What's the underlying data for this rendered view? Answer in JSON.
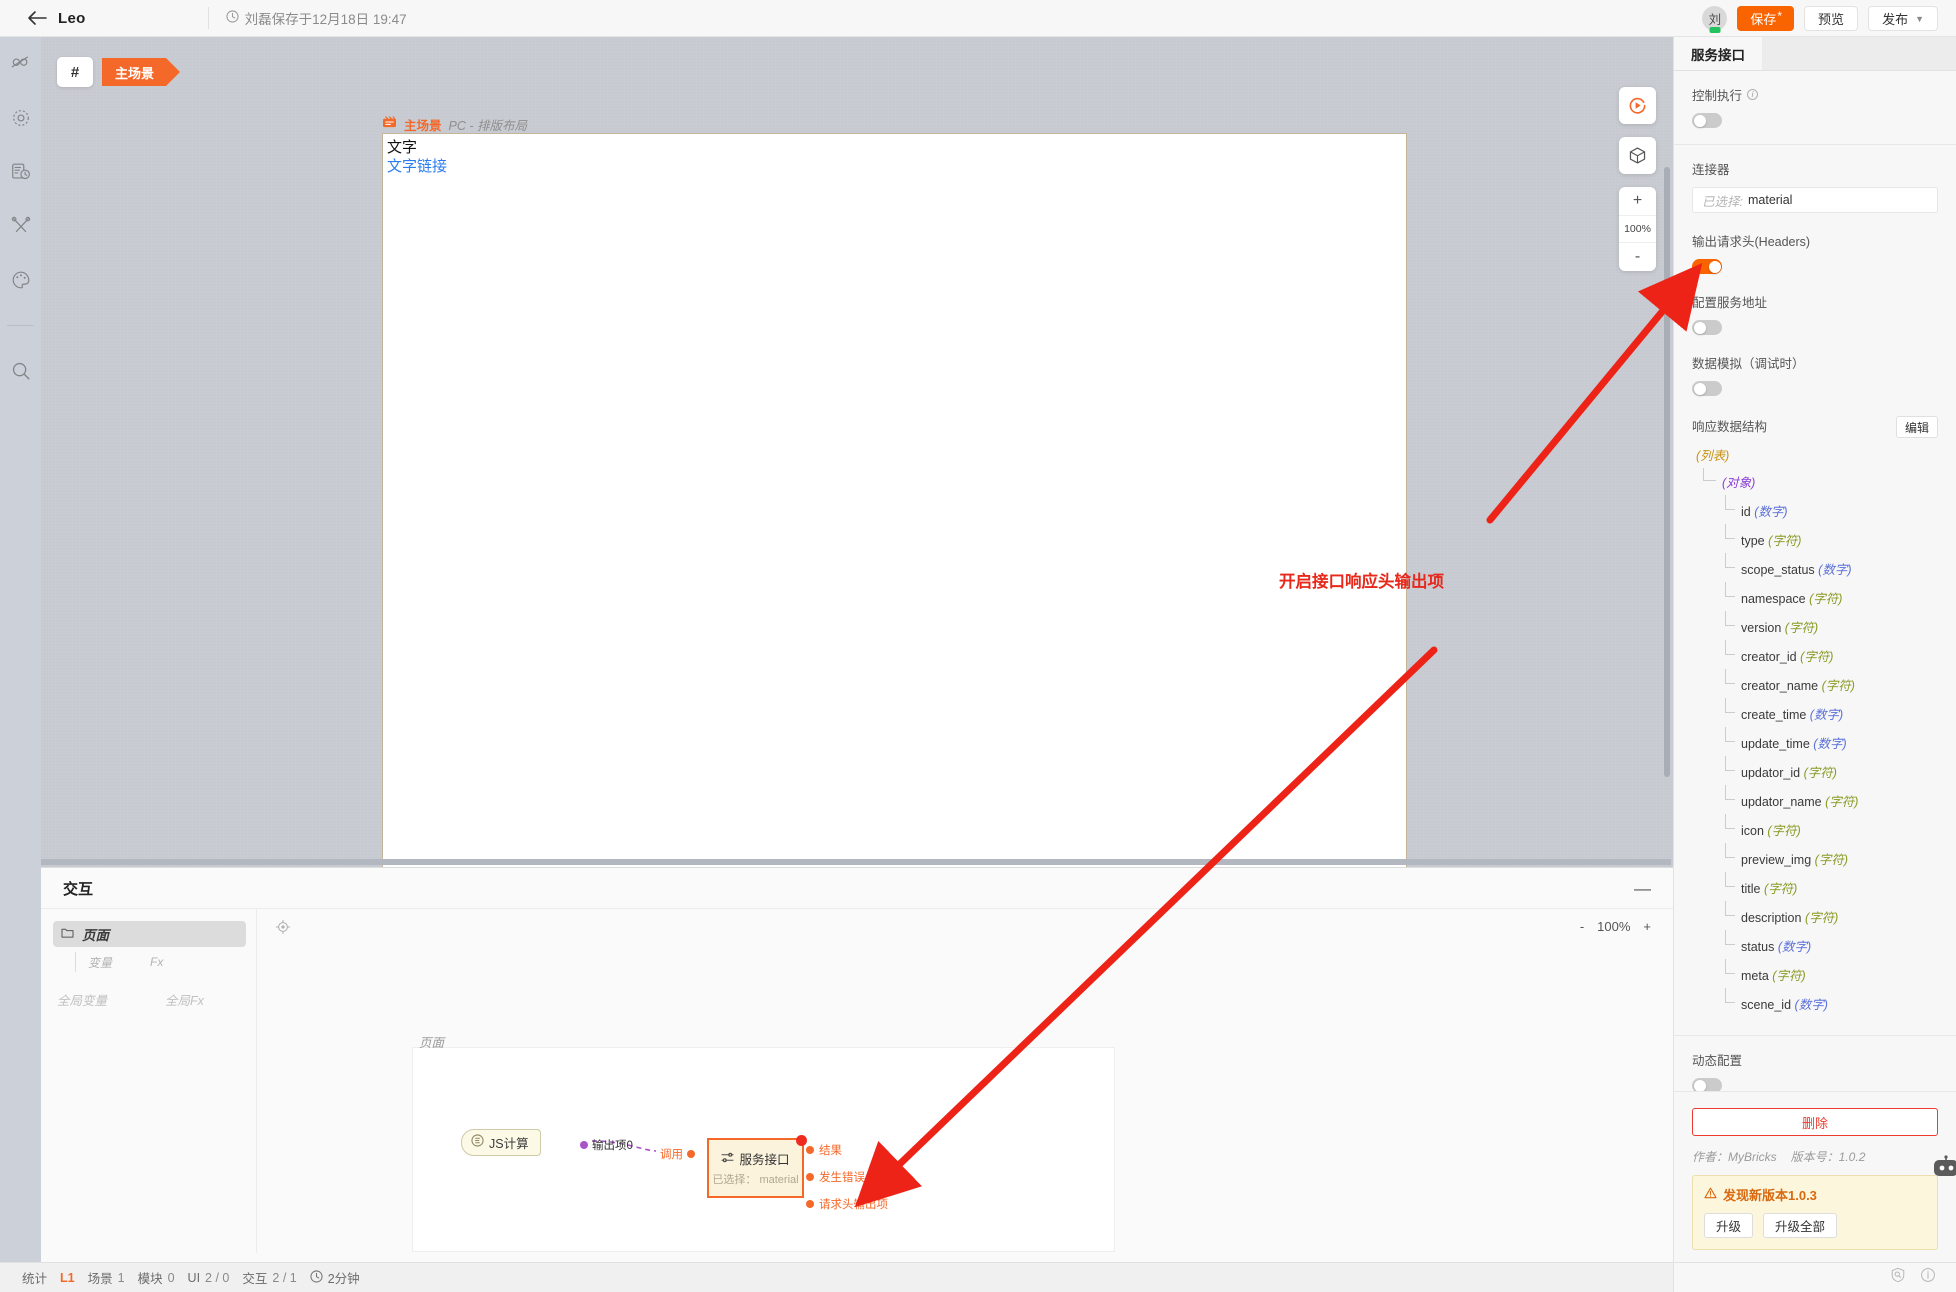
{
  "topbar": {
    "back_icon": "arrow-left-icon",
    "title": "Leo",
    "clock_icon": "clock-icon",
    "save_info": "刘磊保存于12月18日 19:47",
    "avatar_initial": "刘",
    "save_label": "保存",
    "save_star": "*",
    "preview_label": "预览",
    "publish_label": "发布",
    "publish_caret": "chevron-down-icon"
  },
  "rail": {
    "items": [
      {
        "name": "connector-icon",
        "label": "连接器"
      },
      {
        "name": "gear-icon",
        "label": "设置"
      },
      {
        "name": "history-icon",
        "label": "历史"
      },
      {
        "name": "tools-icon",
        "label": "工具"
      },
      {
        "name": "palette-icon",
        "label": "主题"
      },
      {
        "name": "search-icon",
        "label": "搜索"
      }
    ]
  },
  "canvas": {
    "hash_label": "#",
    "scene_tag": "主场景",
    "page_header_icon": "scene-icon",
    "page_header_label": "主场景",
    "page_header_sub": "PC - 排版布局",
    "sheet_text": "文字",
    "sheet_link": "文字链接",
    "tools": {
      "run_icon": "play-circle-icon",
      "cube_icon": "cube-icon",
      "zoom_in": "+",
      "zoom_value": "100%",
      "zoom_out": "-"
    },
    "annotation": "开启接口响应头输出项"
  },
  "interaction": {
    "title": "交互",
    "minimize_icon": "minimize-icon",
    "tree": {
      "folder_icon": "folder-icon",
      "root_label": "页面",
      "sub_items": [
        "变量",
        "Fx"
      ],
      "global_items": [
        "全局变量",
        "全局Fx"
      ]
    },
    "toolbar": {
      "focus_icon": "target-icon",
      "zoom_out": "-",
      "zoom_value": "100%",
      "zoom_in": "+"
    },
    "flow": {
      "frame_label": "页面",
      "js_node": {
        "icon": "js-icon",
        "label": "JS计算"
      },
      "js_output_port": "输出项0",
      "call_port": "调用",
      "api_node": {
        "icon": "api-icon",
        "title": "服务接口",
        "subtitle_prefix": "已选择：",
        "subtitle_value": "material"
      },
      "api_outputs": [
        "结果",
        "发生错误",
        "请求头输出项"
      ]
    }
  },
  "right_panel": {
    "tab_label": "服务接口",
    "control_exec": {
      "label": "控制执行",
      "info_icon": "info-icon",
      "enabled": false
    },
    "connector": {
      "label": "连接器",
      "placeholder": "已选择:",
      "value": "material"
    },
    "output_headers": {
      "label": "输出请求头(Headers)",
      "enabled": true
    },
    "config_service_url": {
      "label": "配置服务地址",
      "enabled": false
    },
    "data_mock": {
      "label": "数据模拟（调试时）",
      "enabled": false
    },
    "response_structure": {
      "label": "响应数据结构",
      "edit_label": "编辑",
      "root_type": "(列表)",
      "object_type": "(对象)",
      "fields": [
        {
          "name": "id",
          "type": "(数字)",
          "kind": "num"
        },
        {
          "name": "type",
          "type": "(字符)",
          "kind": "str"
        },
        {
          "name": "scope_status",
          "type": "(数字)",
          "kind": "num"
        },
        {
          "name": "namespace",
          "type": "(字符)",
          "kind": "str"
        },
        {
          "name": "version",
          "type": "(字符)",
          "kind": "str"
        },
        {
          "name": "creator_id",
          "type": "(字符)",
          "kind": "str"
        },
        {
          "name": "creator_name",
          "type": "(字符)",
          "kind": "str"
        },
        {
          "name": "create_time",
          "type": "(数字)",
          "kind": "num"
        },
        {
          "name": "update_time",
          "type": "(数字)",
          "kind": "num"
        },
        {
          "name": "updator_id",
          "type": "(字符)",
          "kind": "str"
        },
        {
          "name": "updator_name",
          "type": "(字符)",
          "kind": "str"
        },
        {
          "name": "icon",
          "type": "(字符)",
          "kind": "str"
        },
        {
          "name": "preview_img",
          "type": "(字符)",
          "kind": "str"
        },
        {
          "name": "title",
          "type": "(字符)",
          "kind": "str"
        },
        {
          "name": "description",
          "type": "(字符)",
          "kind": "str"
        },
        {
          "name": "status",
          "type": "(数字)",
          "kind": "num"
        },
        {
          "name": "meta",
          "type": "(字符)",
          "kind": "str"
        },
        {
          "name": "scene_id",
          "type": "(数字)",
          "kind": "num"
        }
      ]
    },
    "dynamic_config": {
      "label": "动态配置",
      "enabled": false
    },
    "delete_label": "删除",
    "author_line": "作者：MyBricks",
    "version_line": "版本号：1.0.2",
    "upgrade": {
      "warn_icon": "warning-icon",
      "title": "发现新版本1.0.3",
      "upgrade_label": "升级",
      "upgrade_all_label": "升级全部"
    },
    "bottom_icons": [
      "shield-search-icon",
      "info-circle-icon"
    ]
  },
  "statusbar": {
    "label": "统计",
    "level": "L1",
    "items": [
      {
        "key": "场景",
        "value": "1"
      },
      {
        "key": "模块",
        "value": "0"
      },
      {
        "key": "UI",
        "value": "2 / 0"
      },
      {
        "key": "交互",
        "value": "2 / 1"
      }
    ],
    "clock_icon": "clock-icon",
    "duration": "2分钟"
  },
  "colors": {
    "accent": "#fa6400",
    "danger": "#ec3b30",
    "annotation": "#e8281b",
    "link": "#2b7cf0"
  }
}
